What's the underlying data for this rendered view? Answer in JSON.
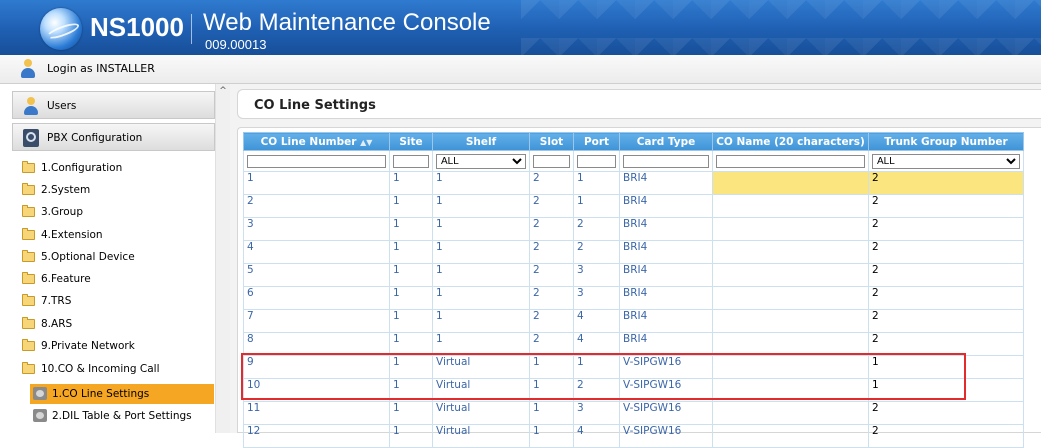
{
  "header": {
    "product_name": "NS1000",
    "title": "Web Maintenance Console",
    "version": "009.00013"
  },
  "login": {
    "text": "Login as INSTALLER"
  },
  "sidebar": {
    "users_label": "Users",
    "pbx_label": "PBX Configuration",
    "folders": [
      "1.Configuration",
      "2.System",
      "3.Group",
      "4.Extension",
      "5.Optional Device",
      "6.Feature",
      "7.TRS",
      "8.ARS",
      "9.Private Network",
      "10.CO & Incoming Call"
    ],
    "subitems": [
      "1.CO Line Settings",
      "2.DIL Table & Port Settings"
    ],
    "scroll_up_glyph": "^"
  },
  "main": {
    "page_title": "CO Line Settings",
    "columns": [
      "CO Line Number",
      "Site",
      "Shelf",
      "Slot",
      "Port",
      "Card Type",
      "CO Name (20 characters)",
      "Trunk Group Number"
    ],
    "sort_glyph": "▲▼",
    "filter": {
      "shelf": "ALL",
      "trunk_group": "ALL"
    },
    "rows": [
      [
        "1",
        "1",
        "1",
        "2",
        "1",
        "BRI4",
        "",
        "2"
      ],
      [
        "2",
        "1",
        "1",
        "2",
        "1",
        "BRI4",
        "",
        "2"
      ],
      [
        "3",
        "1",
        "1",
        "2",
        "2",
        "BRI4",
        "",
        "2"
      ],
      [
        "4",
        "1",
        "1",
        "2",
        "2",
        "BRI4",
        "",
        "2"
      ],
      [
        "5",
        "1",
        "1",
        "2",
        "3",
        "BRI4",
        "",
        "2"
      ],
      [
        "6",
        "1",
        "1",
        "2",
        "3",
        "BRI4",
        "",
        "2"
      ],
      [
        "7",
        "1",
        "1",
        "2",
        "4",
        "BRI4",
        "",
        "2"
      ],
      [
        "8",
        "1",
        "1",
        "2",
        "4",
        "BRI4",
        "",
        "2"
      ],
      [
        "9",
        "1",
        "Virtual",
        "1",
        "1",
        "V-SIPGW16",
        "",
        "1"
      ],
      [
        "10",
        "1",
        "Virtual",
        "1",
        "2",
        "V-SIPGW16",
        "",
        "1"
      ],
      [
        "11",
        "1",
        "Virtual",
        "1",
        "3",
        "V-SIPGW16",
        "",
        "2"
      ],
      [
        "12",
        "1",
        "Virtual",
        "1",
        "4",
        "V-SIPGW16",
        "",
        "2"
      ]
    ]
  },
  "colors": {
    "header_blue": "#1f5fb2",
    "active_item": "#f5a623",
    "highlight_cell": "#fbe57f",
    "annotation_red": "#e32b2b"
  }
}
